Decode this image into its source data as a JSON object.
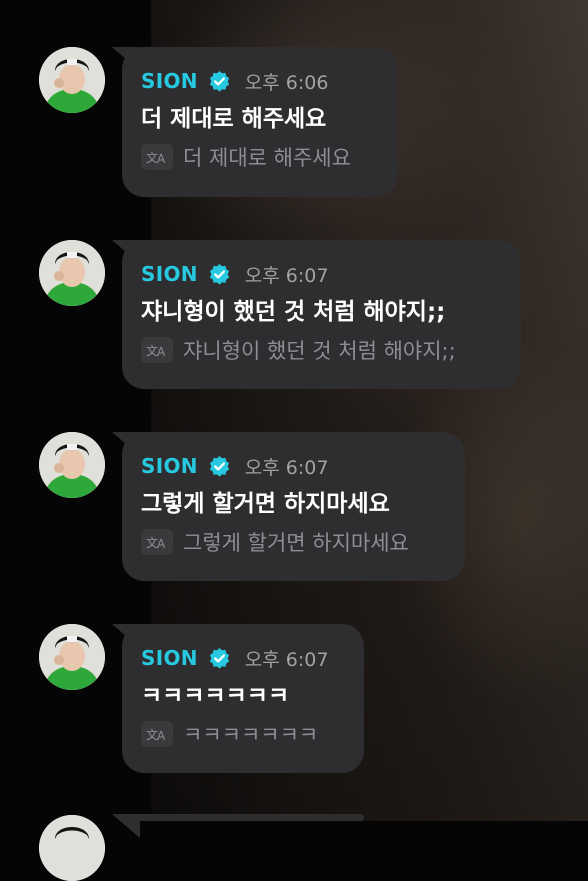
{
  "messages": [
    {
      "sender": "SION",
      "time": "오후 6:06",
      "text": "더 제대로 해주세요",
      "translation": "더 제대로 해주세요"
    },
    {
      "sender": "SION",
      "time": "오후 6:07",
      "text": "쟈니형이 했던 것 처럼 해야지;;",
      "translation": "쟈니형이 했던 것 처럼 해야지;;"
    },
    {
      "sender": "SION",
      "time": "오후 6:07",
      "text": "그렇게 할거면 하지마세요",
      "translation": "그렇게 할거면 하지마세요"
    },
    {
      "sender": "SION",
      "time": "오후 6:07",
      "text": "ㅋㅋㅋㅋㅋㅋㅋ",
      "translation": "ㅋㅋㅋㅋㅋㅋㅋ"
    }
  ],
  "icons": {
    "verified_badge": "verified-check-icon",
    "translate": "translate-icon"
  },
  "colors": {
    "sender_name": "#27c9e0",
    "bubble": "#2e2e30",
    "time": "#a2a2a4",
    "translation_text": "#8e8e92"
  }
}
